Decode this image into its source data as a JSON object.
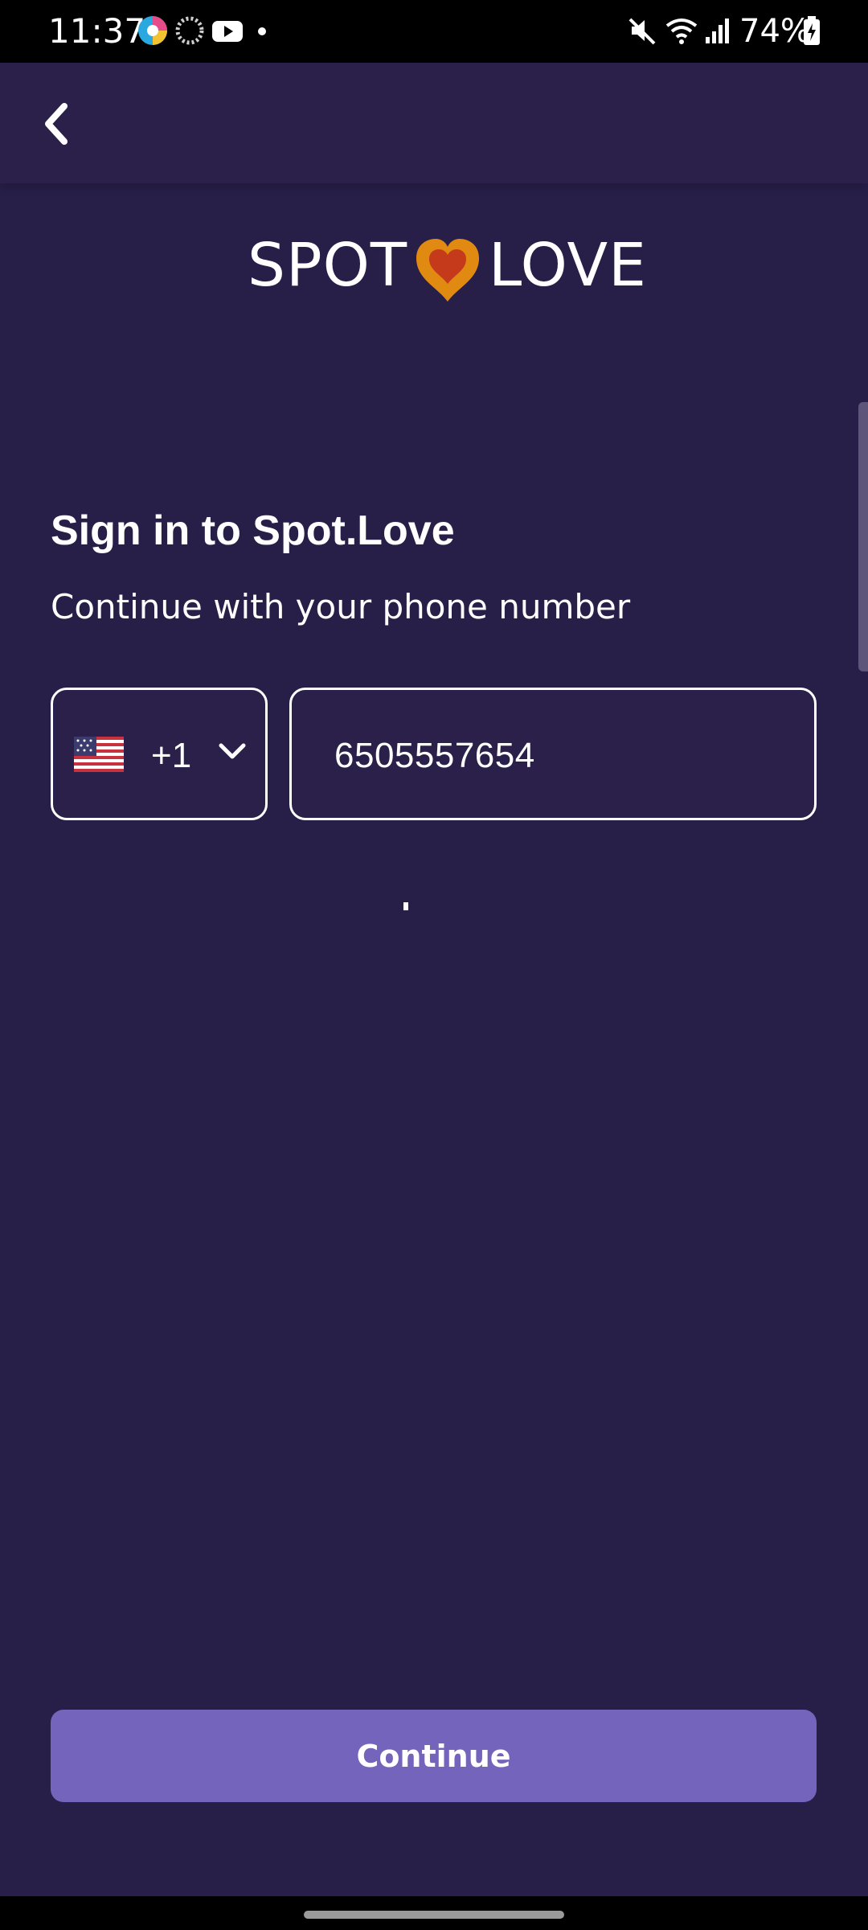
{
  "status_bar": {
    "time": "11:37",
    "battery_text": "74%",
    "icons": [
      "chrome-like-app-icon",
      "loading-circle-icon",
      "youtube-icon",
      "notification-dot-icon",
      "mute-icon",
      "wifi-icon",
      "signal-icon",
      "battery-charging-icon"
    ]
  },
  "app_bar": {
    "back_icon": "chevron-left-icon"
  },
  "logo": {
    "left_text": "SPOT",
    "right_text": "LOVE",
    "heart_colors": [
      "#e08a12",
      "#c43a1a"
    ]
  },
  "sign_in": {
    "title": "Sign in to Spot.Love",
    "subtitle": "Continue with your phone number"
  },
  "phone_form": {
    "country": {
      "flag": "us-flag-icon",
      "code": "+1",
      "dropdown_icon": "chevron-down-icon"
    },
    "phone_number": "6505557654"
  },
  "actions": {
    "continue_label": "Continue"
  },
  "colors": {
    "background": "#281f49",
    "button": "#7564bc",
    "text": "#ffffff"
  }
}
